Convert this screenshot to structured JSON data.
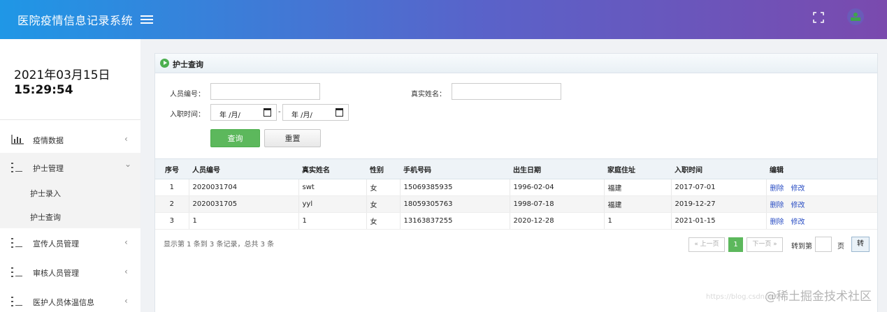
{
  "header": {
    "title": "医院疫情信息记录系统"
  },
  "sidebar": {
    "date": "2021年03月15日",
    "time": "15:29:54",
    "items": [
      {
        "label": "疫情数据",
        "chevron": "‹"
      },
      {
        "label": "护士管理",
        "chevron": "⌄"
      },
      {
        "label": "宣传人员管理",
        "chevron": "‹"
      },
      {
        "label": "审核人员管理",
        "chevron": "‹"
      },
      {
        "label": "医护人员体温信息",
        "chevron": "‹"
      }
    ],
    "subitems": [
      {
        "label": "护士录入"
      },
      {
        "label": "护士查询"
      }
    ]
  },
  "panel": {
    "title": "护士查询"
  },
  "form": {
    "staff_no_label": "人员编号：",
    "real_name_label": "真实姓名：",
    "hire_time_label": "入职时间：",
    "date_placeholder": "年 /月/",
    "dash": "-",
    "query_label": "查询",
    "reset_label": "重置"
  },
  "table": {
    "headers": [
      "序号",
      "人员编号",
      "真实姓名",
      "性别",
      "手机号码",
      "出生日期",
      "家庭住址",
      "入职时间",
      "编辑"
    ],
    "rows": [
      {
        "idx": "1",
        "staff_no": "2020031704",
        "name": "swt",
        "sex": "女",
        "phone": "15069385935",
        "birth": "1996-02-04",
        "address": "福建",
        "hired": "2017-07-01",
        "delete": "删除",
        "edit": "修改"
      },
      {
        "idx": "2",
        "staff_no": "2020031705",
        "name": "yyl",
        "sex": "女",
        "phone": "18059305763",
        "birth": "1998-07-18",
        "address": "福建",
        "hired": "2019-12-27",
        "delete": "删除",
        "edit": "修改"
      },
      {
        "idx": "3",
        "staff_no": "1",
        "name": "1",
        "sex": "女",
        "phone": "13163837255",
        "birth": "2020-12-28",
        "address": "1",
        "hired": "2021-01-15",
        "delete": "删除",
        "edit": "修改"
      }
    ]
  },
  "pager": {
    "summary": "显示第 1 条到 3 条记录，总共 3 条",
    "prev": "« 上一页",
    "page": "1",
    "next": "下一页 »",
    "goto_label": "转到第",
    "page_unit": "页",
    "go": "转"
  },
  "watermark": "@稀土掘金技术社区",
  "watermark_small": "https://blog.csdn.net"
}
